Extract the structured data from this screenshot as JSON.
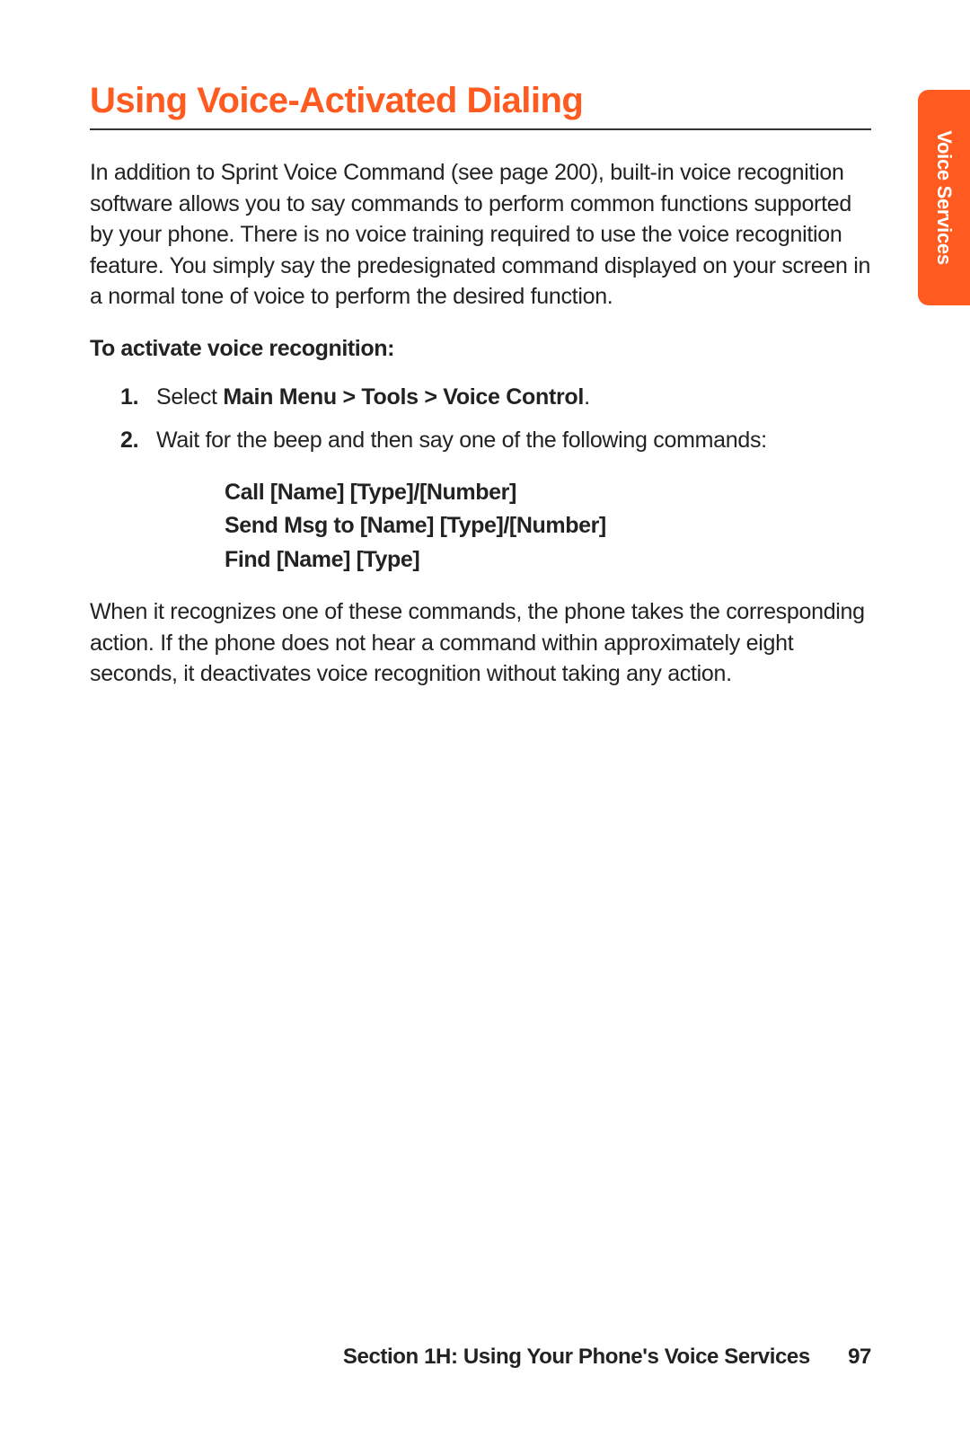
{
  "title": "Using Voice-Activated Dialing",
  "side_tab": "Voice Services",
  "intro": "In addition to Sprint Voice Command (see page 200), built-in voice recognition software allows you to say commands to perform common functions supported by your phone. There is no voice training required to use the voice recognition feature. You simply say the predesignated command displayed on your screen in a normal tone of voice to perform the desired function.",
  "subhead": "To activate voice recognition:",
  "steps": {
    "num1": "1.",
    "step1_a": "Select ",
    "step1_b": "Main Menu > Tools > Voice Control",
    "step1_c": ".",
    "num2": "2.",
    "step2": "Wait for the beep and then say one of the following commands:"
  },
  "commands": {
    "c1": "Call [Name] [Type]/[Number]",
    "c2": "Send Msg to [Name] [Type]/[Number]",
    "c3": "Find [Name] [Type]"
  },
  "closing": "When it recognizes one of these commands, the phone takes the corresponding action. If the phone does not hear a command within approximately eight seconds, it deactivates voice recognition without taking any action.",
  "footer": {
    "section": "Section 1H: Using Your Phone's Voice Services",
    "page": "97"
  }
}
